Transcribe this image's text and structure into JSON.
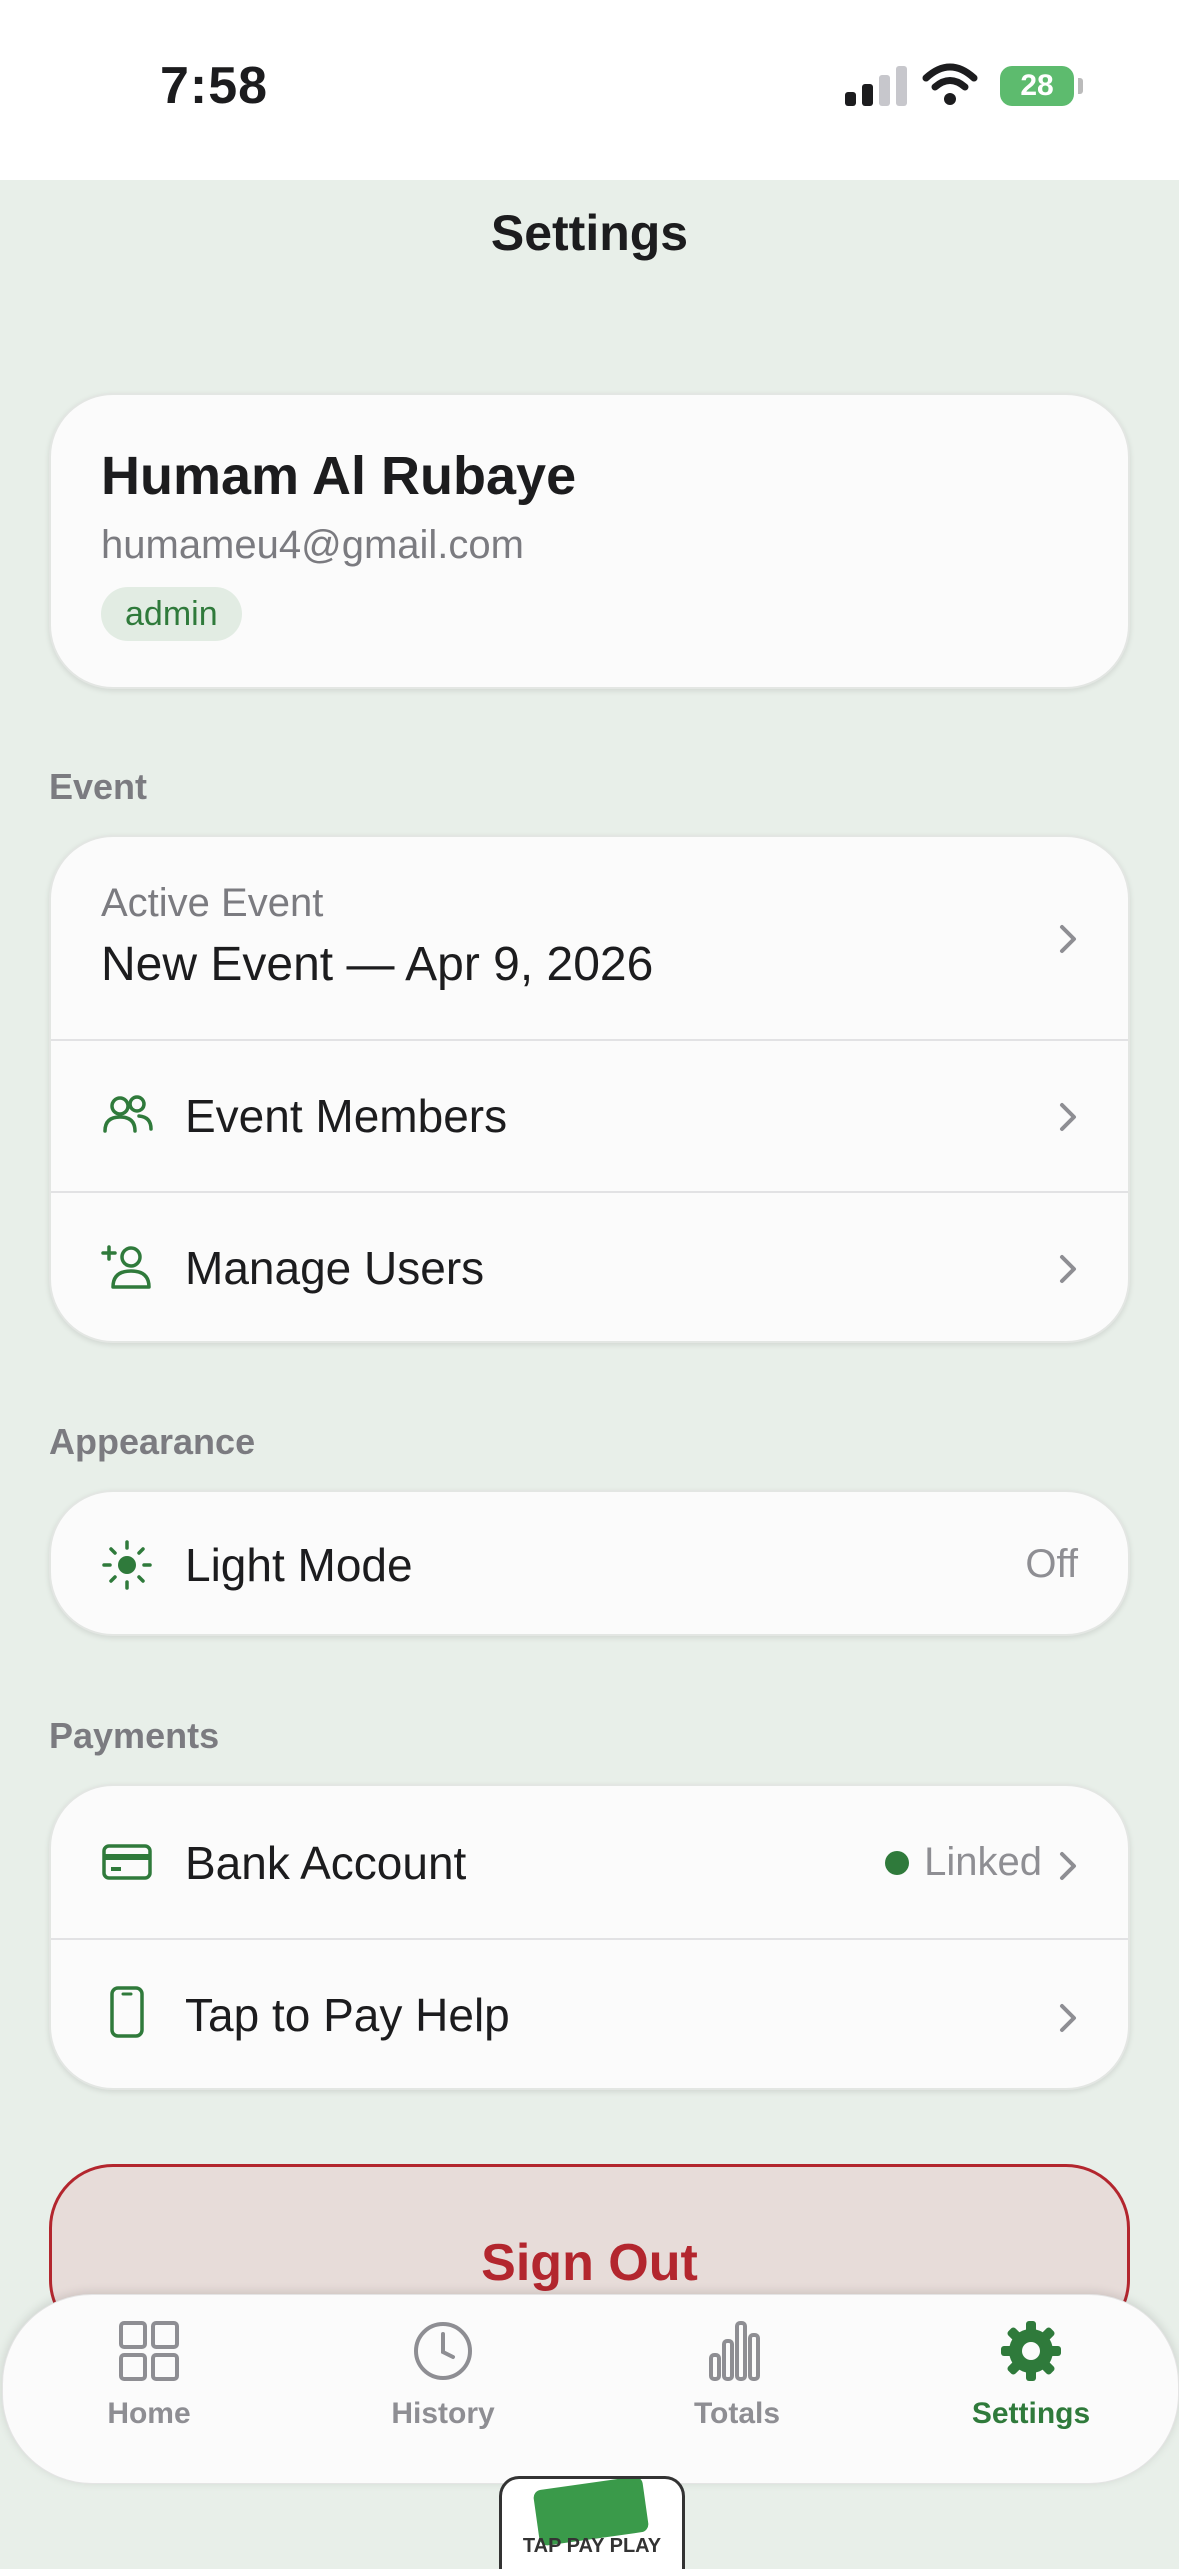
{
  "status_bar": {
    "time": "7:58",
    "battery": "28"
  },
  "header": {
    "title": "Settings"
  },
  "profile": {
    "name": "Humam Al Rubaye",
    "email": "humameu4@gmail.com",
    "role": "admin"
  },
  "sections": {
    "event": {
      "label": "Event",
      "active_event_caption": "Active Event",
      "active_event_value": "New Event — Apr 9, 2026",
      "members_label": "Event Members",
      "manage_users_label": "Manage Users"
    },
    "appearance": {
      "label": "Appearance",
      "light_mode_label": "Light Mode",
      "light_mode_value": "Off"
    },
    "payments": {
      "label": "Payments",
      "bank_label": "Bank Account",
      "bank_status": "Linked",
      "tap_help_label": "Tap to Pay Help"
    }
  },
  "sign_out_label": "Sign Out",
  "tabs": [
    {
      "label": "Home",
      "icon": "grid-icon"
    },
    {
      "label": "History",
      "icon": "clock-icon"
    },
    {
      "label": "Totals",
      "icon": "bar-chart-icon"
    },
    {
      "label": "Settings",
      "icon": "gear-icon",
      "active": true
    }
  ],
  "logo_text": "TAP PAY PLAY",
  "colors": {
    "accent": "#2f7a3b",
    "danger": "#b3262e",
    "background": "#e8efe9"
  }
}
